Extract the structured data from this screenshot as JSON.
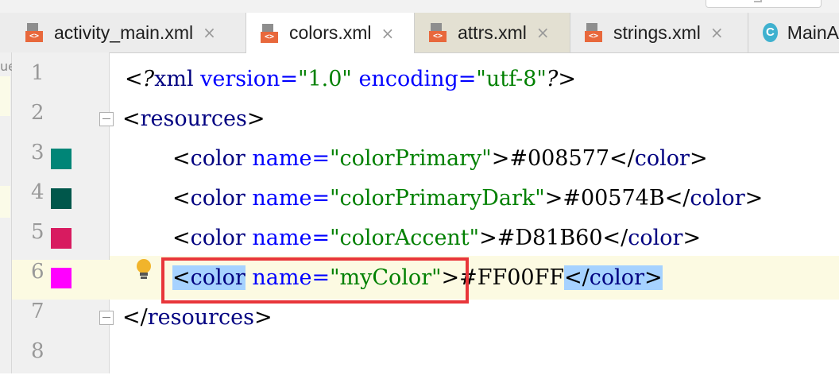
{
  "tabs": [
    {
      "label": "activity_main.xml",
      "icon": "xml-file-icon",
      "closable": true
    },
    {
      "label": "colors.xml",
      "icon": "xml-file-icon",
      "closable": true,
      "active": true
    },
    {
      "label": "attrs.xml",
      "icon": "xml-file-icon",
      "closable": true
    },
    {
      "label": "strings.xml",
      "icon": "xml-file-icon",
      "closable": true
    },
    {
      "label": "MainA",
      "icon": "class-icon",
      "closable": false
    }
  ],
  "close_glyph": "×",
  "xml_badge": "<>",
  "class_badge": "C",
  "left_edge_char": "ue",
  "lines": [
    {
      "num": "1"
    },
    {
      "num": "2"
    },
    {
      "num": "3",
      "swatch": "#008577"
    },
    {
      "num": "4",
      "swatch": "#00574B"
    },
    {
      "num": "5",
      "swatch": "#D81B60"
    },
    {
      "num": "6",
      "swatch": "#FF00FF"
    },
    {
      "num": "7"
    },
    {
      "num": "8"
    }
  ],
  "code": {
    "l1": {
      "open": "<?",
      "name": "xml",
      "attr1": "version",
      "eq": "=",
      "val1": "\"1.0\"",
      "attr2": "encoding",
      "val2": "\"utf-8\"",
      "close": "?>"
    },
    "l2": {
      "lt": "<",
      "tag": "resources",
      "gt": ">"
    },
    "l3": {
      "lt": "<",
      "tag": "color",
      "attr": "name",
      "eq": "=",
      "val": "\"colorPrimary\"",
      "gt": ">",
      "text": "#008577",
      "endlt": "</",
      "endtag": "color",
      "endgt": ">"
    },
    "l4": {
      "lt": "<",
      "tag": "color",
      "attr": "name",
      "eq": "=",
      "val": "\"colorPrimaryDark\"",
      "gt": ">",
      "text": "#00574B",
      "endlt": "</",
      "endtag": "color",
      "endgt": ">"
    },
    "l5": {
      "lt": "<",
      "tag": "color",
      "attr": "name",
      "eq": "=",
      "val": "\"colorAccent\"",
      "gt": ">",
      "text": "#D81B60",
      "endlt": "</",
      "endtag": "color",
      "endgt": ">"
    },
    "l6": {
      "lt": "<",
      "tag": "color",
      "attr": "name",
      "eq": "=",
      "val": "\"myColor\"",
      "gt": ">",
      "text": "#FF00FF",
      "endlt": "</",
      "endtag": "color",
      "endgt": ">"
    },
    "l7": {
      "lt": "</",
      "tag": "resources",
      "gt": ">"
    }
  },
  "colors": {
    "tag": "#000080",
    "attr": "#0000ff",
    "value": "#008000",
    "selection": "#a6d2ff",
    "highlight_box": "#e8363a",
    "current_line": "#fcfae2"
  }
}
